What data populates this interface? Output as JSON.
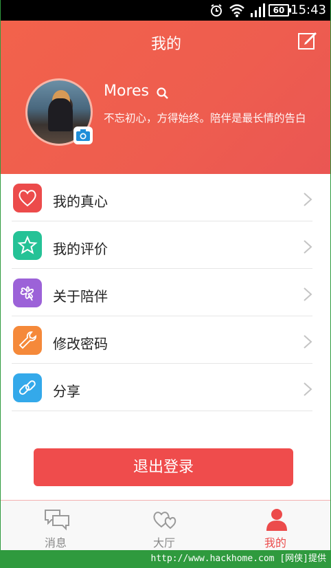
{
  "status_bar": {
    "time": "15:43",
    "battery": "60"
  },
  "header": {
    "title": "我的"
  },
  "profile": {
    "username": "Mores",
    "bio": "不忘初心，方得始终。陪伴是最长情的告白"
  },
  "menu": {
    "items": [
      {
        "label": "我的真心",
        "icon": "heart-icon",
        "color": "#ec4b4b"
      },
      {
        "label": "我的评价",
        "icon": "star-icon",
        "color": "#25c296"
      },
      {
        "label": "关于陪伴",
        "icon": "clover-icon",
        "color": "#9c62d8"
      },
      {
        "label": "修改密码",
        "icon": "wrench-icon",
        "color": "#f5893a"
      },
      {
        "label": "分享",
        "icon": "link-icon",
        "color": "#34a9ea"
      }
    ]
  },
  "logout": {
    "label": "退出登录"
  },
  "tabs": [
    {
      "label": "消息",
      "icon": "message-icon",
      "active": false
    },
    {
      "label": "大厅",
      "icon": "hearts-icon",
      "active": false
    },
    {
      "label": "我的",
      "icon": "person-icon",
      "active": true
    }
  ],
  "footer": {
    "text": "http://www.hackhome.com [网侠]提供"
  },
  "colors": {
    "accent": "#ef4c4c",
    "header": "#ee5d4f"
  }
}
